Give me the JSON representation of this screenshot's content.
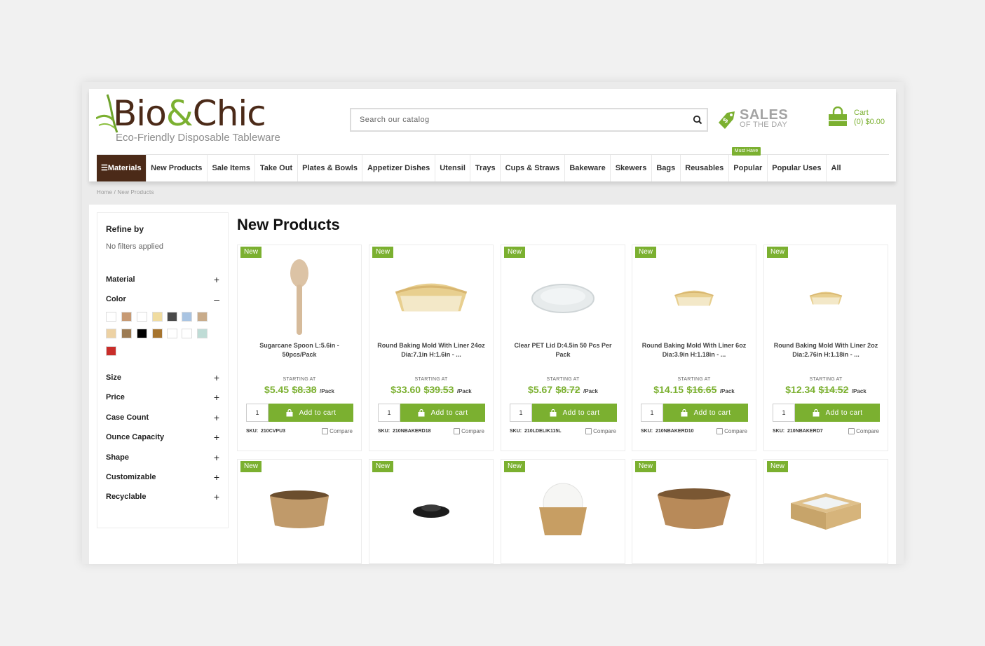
{
  "logo": {
    "brand_left": "Bio",
    "brand_amp": "&",
    "brand_right": "Chic",
    "tagline": "Eco-Friendly Disposable Tableware"
  },
  "search": {
    "placeholder": "Search our catalog"
  },
  "sales": {
    "word": "SALES",
    "sub": "OF THE DAY"
  },
  "cart": {
    "label": "Cart",
    "value": "(0) $0.00"
  },
  "nav": {
    "materials": "Materials",
    "items": [
      "New Products",
      "Sale Items",
      "Take Out",
      "Plates & Bowls",
      "Appetizer Dishes",
      "Utensil",
      "Trays",
      "Cups & Straws",
      "Bakeware",
      "Skewers",
      "Bags",
      "Reusables",
      "Popular",
      "Popular Uses",
      "All"
    ],
    "must_have": "Must Have"
  },
  "breadcrumb": {
    "home": "Home",
    "sep": "/",
    "current": "New Products"
  },
  "sidebar": {
    "refine_by": "Refine by",
    "no_filters": "No filters applied",
    "facets": [
      {
        "label": "Material",
        "sign": "+"
      },
      {
        "label": "Color",
        "sign": "–"
      },
      {
        "label": "Size",
        "sign": "+"
      },
      {
        "label": "Price",
        "sign": "+"
      },
      {
        "label": "Case Count",
        "sign": "+"
      },
      {
        "label": "Ounce Capacity",
        "sign": "+"
      },
      {
        "label": "Shape",
        "sign": "+"
      },
      {
        "label": "Customizable",
        "sign": "+"
      },
      {
        "label": "Recyclable",
        "sign": "+"
      }
    ],
    "swatch_colors": [
      "#ffffff",
      "#c79a74",
      "#ffffff",
      "#f0dca0",
      "#4a4a4a",
      "#a9c4e2",
      "#c8ab8a",
      "#edd2a4",
      "#9c7b53",
      "#000000",
      "#a6742e",
      "#ffffff",
      "#ffffff",
      "#bfdcd6",
      "#c92d2a"
    ]
  },
  "page_title": "New Products",
  "labels": {
    "new_badge": "New",
    "starting_at": "STARTING AT",
    "add_to_cart": "Add to cart",
    "compare": "Compare",
    "sku_prefix": "SKU:"
  },
  "products": [
    {
      "name": "Sugarcane Spoon L:5.6in - 50pcs/Pack",
      "price": "$5.45",
      "old_price": "$8.38",
      "unit": "/Pack",
      "qty": "1",
      "sku": "210CVPU3",
      "image": "spoon-icon"
    },
    {
      "name": "Round Baking Mold With Liner 24oz Dia:7.1in H:1.6in - ...",
      "price": "$33.60",
      "old_price": "$39.53",
      "unit": "/Pack",
      "qty": "1",
      "sku": "210NBAKERD18",
      "image": "baking-mold-icon"
    },
    {
      "name": "Clear PET Lid D:4.5in 50 Pcs Per Pack",
      "price": "$5.67",
      "old_price": "$8.72",
      "unit": "/Pack",
      "qty": "1",
      "sku": "210LDELIK115L",
      "image": "clear-lid-icon"
    },
    {
      "name": "Round Baking Mold With Liner 6oz Dia:3.9in H:1.18in - ...",
      "price": "$14.15",
      "old_price": "$16.65",
      "unit": "/Pack",
      "qty": "1",
      "sku": "210NBAKERD10",
      "image": "baking-mold-icon"
    },
    {
      "name": "Round Baking Mold With Liner 2oz Dia:2.76in H:1.18in - ...",
      "price": "$12.34",
      "old_price": "$14.52",
      "unit": "/Pack",
      "qty": "1",
      "sku": "210NBAKERD7",
      "image": "baking-mold-icon"
    }
  ],
  "products_row2": [
    {
      "image": "kraft-bowl-icon"
    },
    {
      "image": "black-lid-icon"
    },
    {
      "image": "cone-holder-icon"
    },
    {
      "image": "kraft-salad-bowl-icon"
    },
    {
      "image": "window-box-icon"
    }
  ]
}
